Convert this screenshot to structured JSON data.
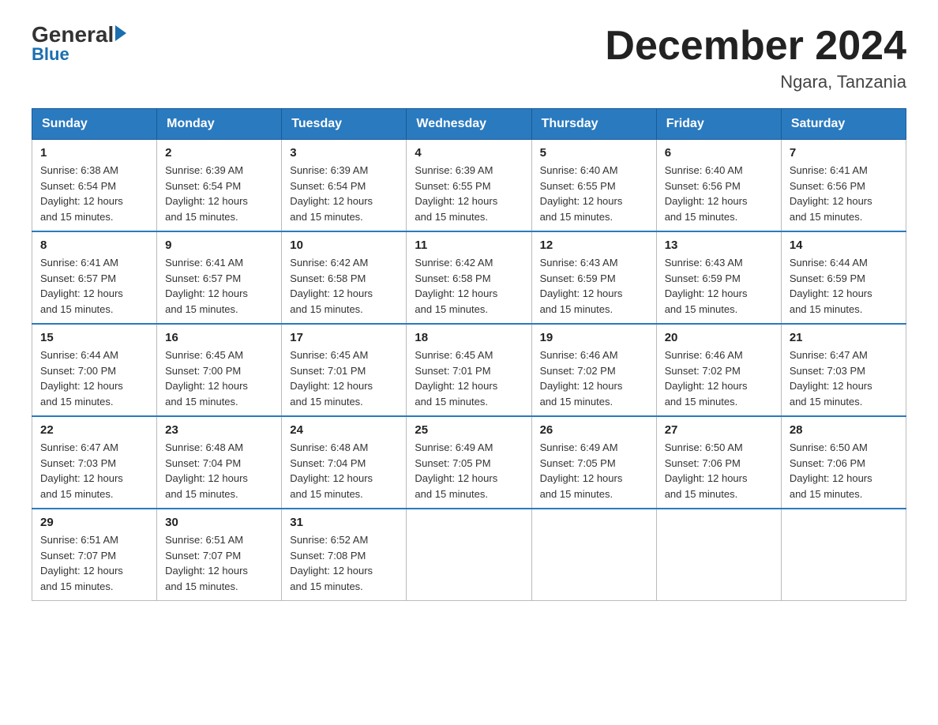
{
  "header": {
    "logo_text": "General",
    "logo_subtext": "Blue",
    "month_title": "December 2024",
    "location": "Ngara, Tanzania"
  },
  "days_of_week": [
    "Sunday",
    "Monday",
    "Tuesday",
    "Wednesday",
    "Thursday",
    "Friday",
    "Saturday"
  ],
  "weeks": [
    [
      {
        "num": "1",
        "sunrise": "6:38 AM",
        "sunset": "6:54 PM",
        "daylight": "12 hours and 15 minutes."
      },
      {
        "num": "2",
        "sunrise": "6:39 AM",
        "sunset": "6:54 PM",
        "daylight": "12 hours and 15 minutes."
      },
      {
        "num": "3",
        "sunrise": "6:39 AM",
        "sunset": "6:54 PM",
        "daylight": "12 hours and 15 minutes."
      },
      {
        "num": "4",
        "sunrise": "6:39 AM",
        "sunset": "6:55 PM",
        "daylight": "12 hours and 15 minutes."
      },
      {
        "num": "5",
        "sunrise": "6:40 AM",
        "sunset": "6:55 PM",
        "daylight": "12 hours and 15 minutes."
      },
      {
        "num": "6",
        "sunrise": "6:40 AM",
        "sunset": "6:56 PM",
        "daylight": "12 hours and 15 minutes."
      },
      {
        "num": "7",
        "sunrise": "6:41 AM",
        "sunset": "6:56 PM",
        "daylight": "12 hours and 15 minutes."
      }
    ],
    [
      {
        "num": "8",
        "sunrise": "6:41 AM",
        "sunset": "6:57 PM",
        "daylight": "12 hours and 15 minutes."
      },
      {
        "num": "9",
        "sunrise": "6:41 AM",
        "sunset": "6:57 PM",
        "daylight": "12 hours and 15 minutes."
      },
      {
        "num": "10",
        "sunrise": "6:42 AM",
        "sunset": "6:58 PM",
        "daylight": "12 hours and 15 minutes."
      },
      {
        "num": "11",
        "sunrise": "6:42 AM",
        "sunset": "6:58 PM",
        "daylight": "12 hours and 15 minutes."
      },
      {
        "num": "12",
        "sunrise": "6:43 AM",
        "sunset": "6:59 PM",
        "daylight": "12 hours and 15 minutes."
      },
      {
        "num": "13",
        "sunrise": "6:43 AM",
        "sunset": "6:59 PM",
        "daylight": "12 hours and 15 minutes."
      },
      {
        "num": "14",
        "sunrise": "6:44 AM",
        "sunset": "6:59 PM",
        "daylight": "12 hours and 15 minutes."
      }
    ],
    [
      {
        "num": "15",
        "sunrise": "6:44 AM",
        "sunset": "7:00 PM",
        "daylight": "12 hours and 15 minutes."
      },
      {
        "num": "16",
        "sunrise": "6:45 AM",
        "sunset": "7:00 PM",
        "daylight": "12 hours and 15 minutes."
      },
      {
        "num": "17",
        "sunrise": "6:45 AM",
        "sunset": "7:01 PM",
        "daylight": "12 hours and 15 minutes."
      },
      {
        "num": "18",
        "sunrise": "6:45 AM",
        "sunset": "7:01 PM",
        "daylight": "12 hours and 15 minutes."
      },
      {
        "num": "19",
        "sunrise": "6:46 AM",
        "sunset": "7:02 PM",
        "daylight": "12 hours and 15 minutes."
      },
      {
        "num": "20",
        "sunrise": "6:46 AM",
        "sunset": "7:02 PM",
        "daylight": "12 hours and 15 minutes."
      },
      {
        "num": "21",
        "sunrise": "6:47 AM",
        "sunset": "7:03 PM",
        "daylight": "12 hours and 15 minutes."
      }
    ],
    [
      {
        "num": "22",
        "sunrise": "6:47 AM",
        "sunset": "7:03 PM",
        "daylight": "12 hours and 15 minutes."
      },
      {
        "num": "23",
        "sunrise": "6:48 AM",
        "sunset": "7:04 PM",
        "daylight": "12 hours and 15 minutes."
      },
      {
        "num": "24",
        "sunrise": "6:48 AM",
        "sunset": "7:04 PM",
        "daylight": "12 hours and 15 minutes."
      },
      {
        "num": "25",
        "sunrise": "6:49 AM",
        "sunset": "7:05 PM",
        "daylight": "12 hours and 15 minutes."
      },
      {
        "num": "26",
        "sunrise": "6:49 AM",
        "sunset": "7:05 PM",
        "daylight": "12 hours and 15 minutes."
      },
      {
        "num": "27",
        "sunrise": "6:50 AM",
        "sunset": "7:06 PM",
        "daylight": "12 hours and 15 minutes."
      },
      {
        "num": "28",
        "sunrise": "6:50 AM",
        "sunset": "7:06 PM",
        "daylight": "12 hours and 15 minutes."
      }
    ],
    [
      {
        "num": "29",
        "sunrise": "6:51 AM",
        "sunset": "7:07 PM",
        "daylight": "12 hours and 15 minutes."
      },
      {
        "num": "30",
        "sunrise": "6:51 AM",
        "sunset": "7:07 PM",
        "daylight": "12 hours and 15 minutes."
      },
      {
        "num": "31",
        "sunrise": "6:52 AM",
        "sunset": "7:08 PM",
        "daylight": "12 hours and 15 minutes."
      },
      null,
      null,
      null,
      null
    ]
  ],
  "labels": {
    "sunrise": "Sunrise:",
    "sunset": "Sunset:",
    "daylight": "Daylight:"
  }
}
